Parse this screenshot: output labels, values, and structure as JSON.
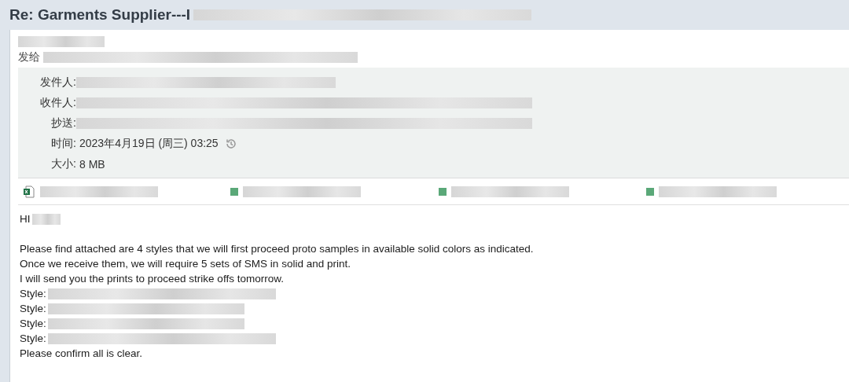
{
  "subject": "Re: Garments Supplier---I",
  "sent_to_label": "发给",
  "header": [
    {
      "label": "发件人:",
      "kind": "redacted"
    },
    {
      "label": "收件人:",
      "kind": "redacted"
    },
    {
      "label": "抄送:",
      "kind": "redacted"
    },
    {
      "label": "时间:",
      "kind": "time",
      "value": "2023年4月19日 (周三) 03:25"
    },
    {
      "label": "大小:",
      "kind": "text",
      "value": "8 MB"
    }
  ],
  "attachments": [
    {
      "kind": "spreadsheet"
    },
    {
      "kind": "redacted"
    },
    {
      "kind": "redacted"
    },
    {
      "kind": "redacted"
    }
  ],
  "body": {
    "greeting": "HI",
    "lines": [
      {
        "kind": "blank"
      },
      {
        "kind": "text",
        "text": "Please find attached are 4 styles that we will first proceed proto samples in available solid colors as indicated."
      },
      {
        "kind": "text",
        "text": "Once we receive them, we will require 5 sets of SMS in solid and print."
      },
      {
        "kind": "text",
        "text": "I will send you the prints to proceed strike offs tomorrow."
      },
      {
        "kind": "style",
        "text": "Style:"
      },
      {
        "kind": "style",
        "text": "Style:"
      },
      {
        "kind": "style",
        "text": "Style:"
      },
      {
        "kind": "style",
        "text": "Style:"
      },
      {
        "kind": "text",
        "text": "Please confirm all is clear."
      }
    ]
  }
}
